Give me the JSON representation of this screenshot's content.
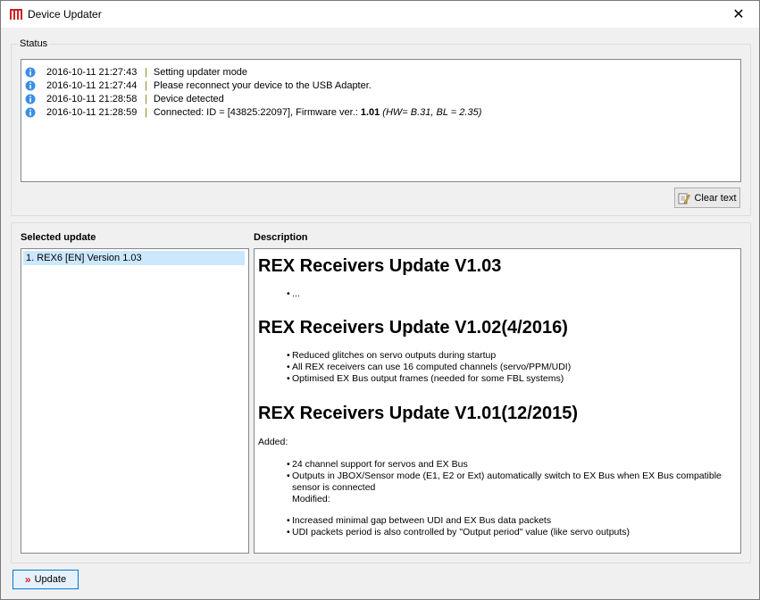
{
  "window": {
    "title": "Device Updater"
  },
  "status": {
    "legend": "Status",
    "log": [
      {
        "time": "2016-10-11 21:27:43",
        "sep": "|",
        "msg": "Setting updater mode"
      },
      {
        "time": "2016-10-11 21:27:44",
        "sep": "|",
        "msg": "Please reconnect your device to the USB Adapter."
      },
      {
        "time": "2016-10-11 21:28:58",
        "sep": "|",
        "msg": "Device detected"
      },
      {
        "time": "2016-10-11 21:28:59",
        "sep": "|",
        "msg": "Connected: ID = [43825:22097], Firmware ver.:",
        "bold": "1.01",
        "extra": "(HW= B.31, BL = 2.35)"
      }
    ],
    "clear_label": "Clear text"
  },
  "selected_update": {
    "label": "Selected update",
    "items": [
      "1. REX6 [EN] Version  1.03"
    ]
  },
  "description": {
    "label": "Description",
    "h1": "REX Receivers Update V1.03",
    "h1_bullet": "...",
    "h2": "REX Receivers Update V1.02(4/2016)",
    "h2_bullets": [
      "Reduced glitches on servo outputs during startup",
      "All REX receivers can use 16 computed channels (servo/PPM/UDI)",
      "Optimised EX Bus output frames (needed for some FBL systems)"
    ],
    "h3": "REX Receivers Update V1.01(12/2015)",
    "added": "Added:",
    "h3_bullets_a": [
      "24 channel support for servos and EX Bus",
      "Outputs in JBOX/Sensor mode (E1, E2 or Ext) automatically switch to EX Bus when EX Bus compatible"
    ],
    "h3_cont": "sensor is connected",
    "modified": "Modified:",
    "h3_bullets_b": [
      "Increased minimal gap between UDI and EX Bus data packets",
      "UDI packets period is also controlled by \"Output period\" value (like servo outputs)"
    ]
  },
  "update_label": "Update",
  "colors": {
    "accent": "#0078d7",
    "selection": "#cce8ff",
    "arrow": "#e02020"
  }
}
